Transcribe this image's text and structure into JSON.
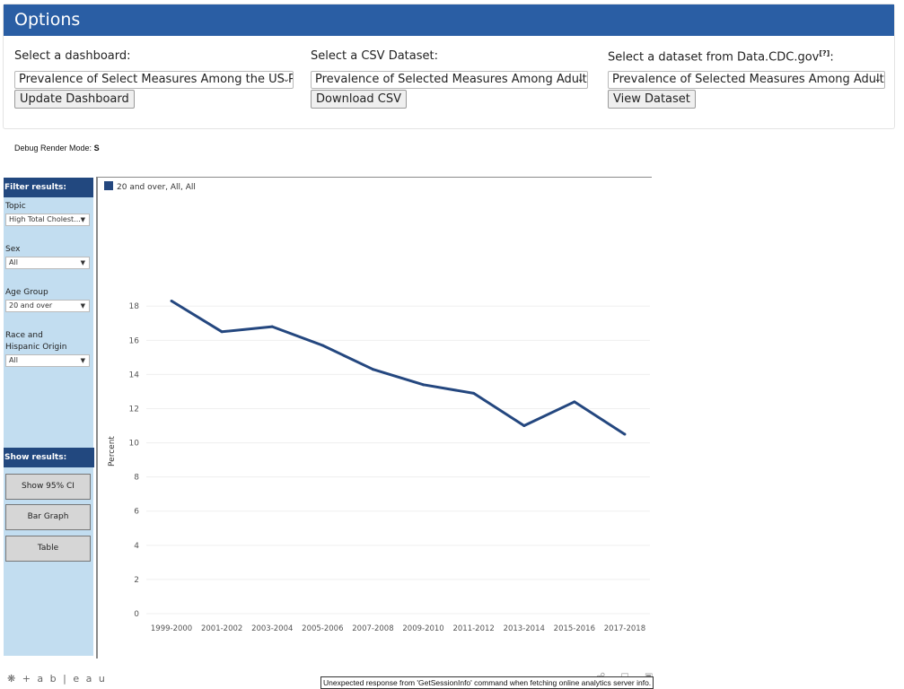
{
  "options": {
    "title": "Options",
    "dashboard": {
      "label": "Select a dashboard:",
      "selected": "Prevalence of Select Measures Among the US Pop",
      "button": "Update Dashboard"
    },
    "csv": {
      "label": "Select a CSV Dataset:",
      "selected": "Prevalence of Selected Measures Among Adults A",
      "button": "Download CSV"
    },
    "cdc": {
      "label": "Select a dataset from Data.CDC.gov",
      "help_marker": "[?]",
      "label_suffix": ":",
      "selected": "Prevalence of Selected Measures Among Adults A",
      "button": "View Dataset"
    }
  },
  "debug": {
    "label": "Debug Render Mode:",
    "value": "S"
  },
  "sidebar": {
    "filter_header": "Filter results:",
    "filters": [
      {
        "label": "Topic",
        "value": "High Total Cholest..."
      },
      {
        "label": "Sex",
        "value": "All"
      },
      {
        "label": "Age Group",
        "value": "20 and over"
      },
      {
        "label_line1": "Race and",
        "label_line2": "Hispanic Origin",
        "value": "All"
      }
    ],
    "show_header": "Show results:",
    "buttons": [
      "Show 95% CI",
      "Bar Graph",
      "Table"
    ]
  },
  "chart_data": {
    "type": "line",
    "title": "",
    "xlabel": "",
    "ylabel": "Percent",
    "categories": [
      "1999-2000",
      "2001-2002",
      "2003-2004",
      "2005-2006",
      "2007-2008",
      "2009-2010",
      "2011-2012",
      "2013-2014",
      "2015-2016",
      "2017-2018"
    ],
    "series": [
      {
        "name": "20 and over, All, All",
        "color": "#24477f",
        "values": [
          18.3,
          16.5,
          16.8,
          15.7,
          14.3,
          13.4,
          12.9,
          11.0,
          12.4,
          10.5
        ]
      }
    ],
    "yticks": [
      0,
      2,
      4,
      6,
      8,
      10,
      12,
      14,
      16,
      18
    ],
    "ylim": [
      0,
      18.8
    ],
    "grid": true,
    "legend": "top-left"
  },
  "footer": {
    "logo": "+ a b | e a u",
    "error": "Unexpected response from 'GetSessionInfo' command when fetching online analytics server info."
  }
}
